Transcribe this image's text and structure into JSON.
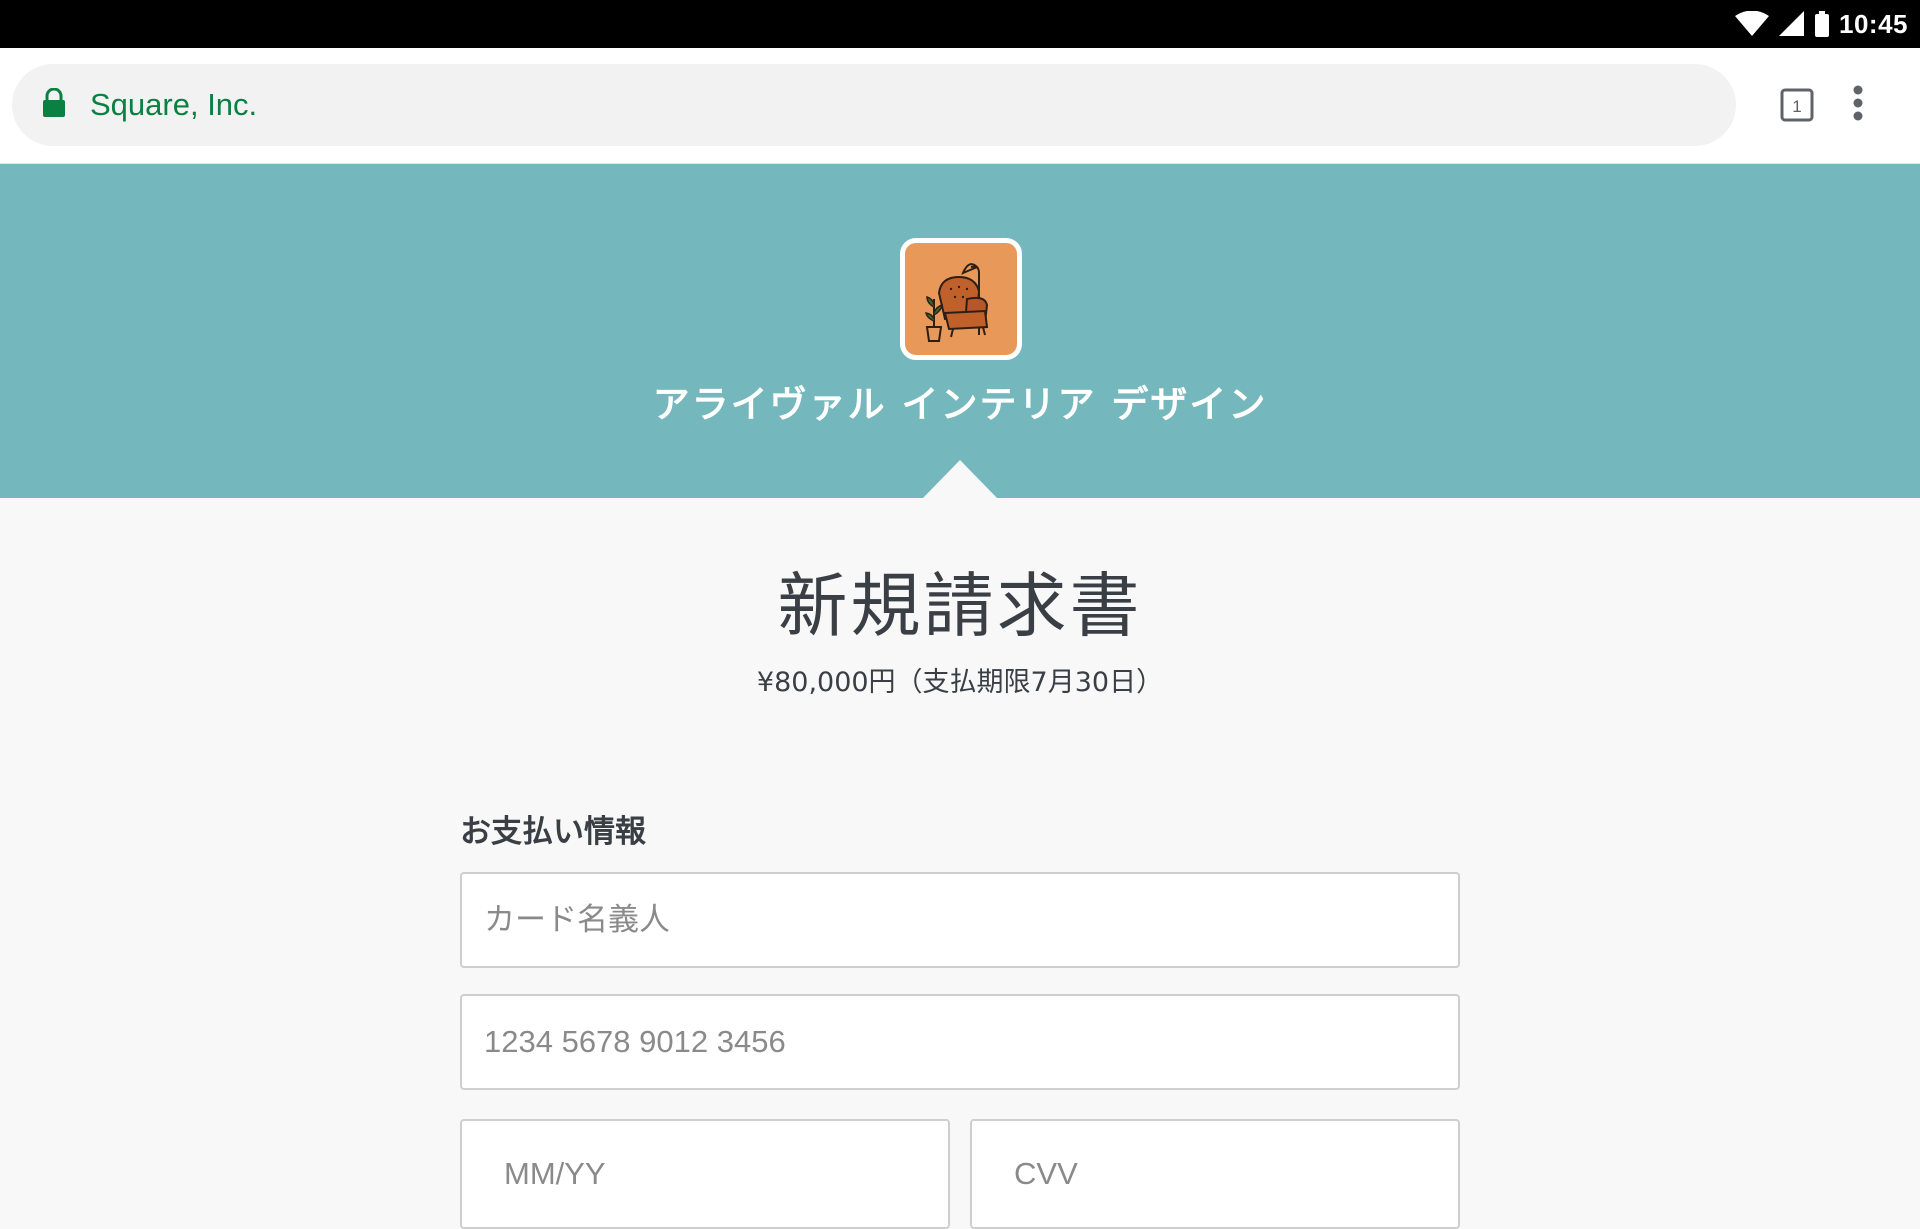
{
  "status_bar": {
    "time": "10:45",
    "icons": [
      "wifi-icon",
      "signal-icon",
      "battery-icon"
    ]
  },
  "browser": {
    "url_label": "Square, Inc.",
    "tab_count": "1",
    "secure_icon": "lock-icon",
    "colors": {
      "secure_text": "#0b8043"
    }
  },
  "merchant": {
    "name": "アライヴァル インテリア デザイン",
    "logo_icon": "armchair-logo",
    "header_color": "#74b7bc",
    "logo_bg": "#e89858"
  },
  "invoice": {
    "title": "新規請求書",
    "amount_due": "¥80,000円（支払期限7月30日）"
  },
  "payment": {
    "heading": "お支払い情報",
    "cardholder_placeholder": "カード名義人",
    "card_number_placeholder": "1234 5678 9012 3456",
    "expiry_placeholder": "MM/YY",
    "cvv_placeholder": "CVV"
  }
}
